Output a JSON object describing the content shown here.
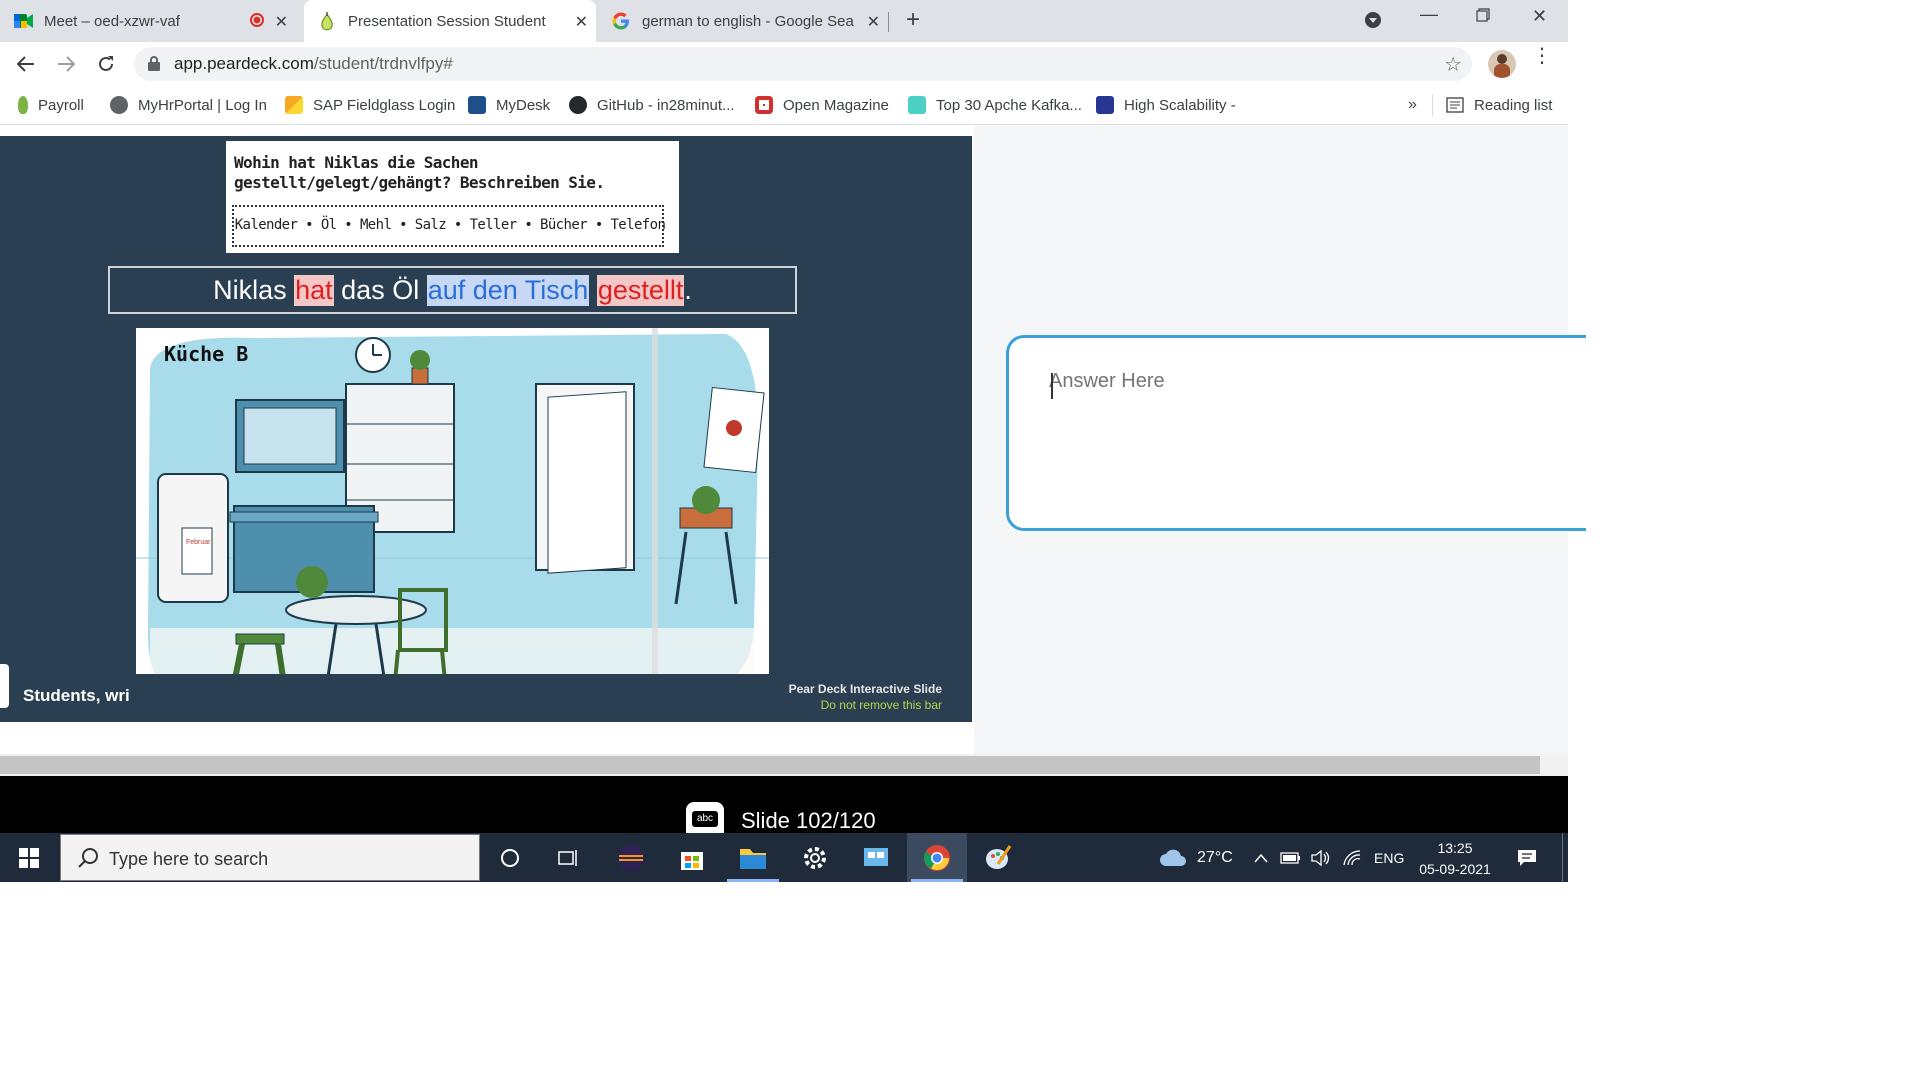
{
  "browser": {
    "tabs": [
      {
        "title": "Meet – oed-xzwr-vaf",
        "active": false,
        "recording": true
      },
      {
        "title": "Presentation Session Student",
        "active": true
      },
      {
        "title": "german to english - Google Sear",
        "active": false
      }
    ],
    "new_tab": "+",
    "url_host": "app.peardeck.com",
    "url_path": "/student/trdnvlfpy#",
    "bookmarks": [
      {
        "label": "Payroll",
        "color": "#7cb342"
      },
      {
        "label": "MyHrPortal | Log In",
        "color": "#5f6368"
      },
      {
        "label": "SAP Fieldglass Login",
        "color": "#f9a825"
      },
      {
        "label": "MyDesk",
        "color": "#1e4f8a"
      },
      {
        "label": "GitHub - in28minut...",
        "color": "#24292e"
      },
      {
        "label": "Open Magazine",
        "color": "#d32f2f"
      },
      {
        "label": "Top 30 Apche Kafka...",
        "color": "#4dd0c4"
      },
      {
        "label": "High Scalability -",
        "color": "#283593"
      }
    ],
    "more_bookmarks": "»",
    "reading_list": "Reading list"
  },
  "slide": {
    "task_question": "Wohin hat Niklas die Sachen gestellt/gelegt/gehängt? Beschreiben Sie.",
    "word_list": "Kalender • Öl • Mehl • Salz • Teller • Bücher • Telefon",
    "sentence": {
      "w1": "Niklas ",
      "w2": "hat",
      "w3": " das Öl ",
      "w4": "auf den Tisch",
      "w5": " ",
      "w6": "gestellt",
      "w7": "."
    },
    "image_label": "Küche B",
    "calendar_text": "Februar",
    "prompt_text": "Students, wri",
    "peardeck_title": "Pear Deck Interactive Slide",
    "peardeck_warning": "Do not remove this bar"
  },
  "answer": {
    "placeholder": "Answer Here"
  },
  "deck": {
    "icon_text": "abc",
    "slide_counter": "Slide 102/120"
  },
  "taskbar": {
    "search_placeholder": "Type here to search",
    "temperature": "27°C",
    "language": "ENG",
    "time": "13:25",
    "date": "05-09-2021"
  }
}
